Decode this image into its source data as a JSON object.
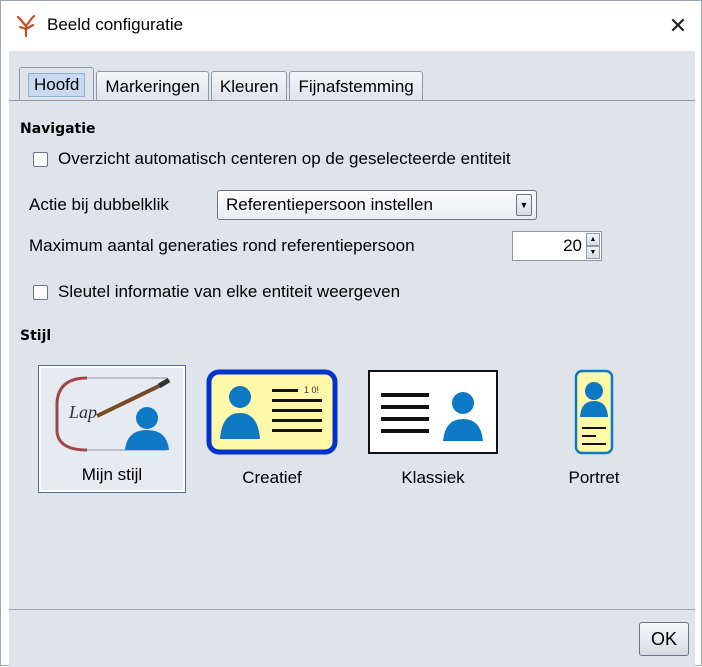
{
  "window": {
    "title": "Beeld configuratie",
    "close_glyph": "✕",
    "app_icon": "tree-figure-icon"
  },
  "tabs": [
    {
      "label": "Hoofd",
      "active": true
    },
    {
      "label": "Markeringen",
      "active": false
    },
    {
      "label": "Kleuren",
      "active": false
    },
    {
      "label": "Fijnafstemming",
      "active": false
    }
  ],
  "navigation": {
    "heading": "Navigatie",
    "auto_center_label": "Overzicht automatisch centeren op de geselecteerde entiteit",
    "auto_center_checked": false,
    "double_click_label": "Actie bij dubbelklik",
    "double_click_value": "Referentiepersoon instellen",
    "max_generations_label": "Maximum aantal generaties rond referentiepersoon",
    "max_generations_value": "20",
    "show_key_info_label": "Sleutel informatie van elke entiteit weergeven",
    "show_key_info_checked": false
  },
  "style": {
    "heading": "Stijl",
    "options": [
      {
        "label": "Mijn stijl",
        "selected": true,
        "icon": "lap-palette-icon"
      },
      {
        "label": "Creatief",
        "selected": false,
        "icon": "creative-card-icon"
      },
      {
        "label": "Klassiek",
        "selected": false,
        "icon": "classic-card-icon"
      },
      {
        "label": "Portret",
        "selected": false,
        "icon": "portrait-card-icon"
      }
    ],
    "thumb_text_lap": "Lap",
    "thumb_text_creative_badge": "1 0!"
  },
  "footer": {
    "ok_label": "OK"
  },
  "colors": {
    "client_bg": "#dfe3ea",
    "person_blue": "#0d78c4",
    "creative_border": "#0033cc",
    "card_yellow": "#fff8a8"
  }
}
